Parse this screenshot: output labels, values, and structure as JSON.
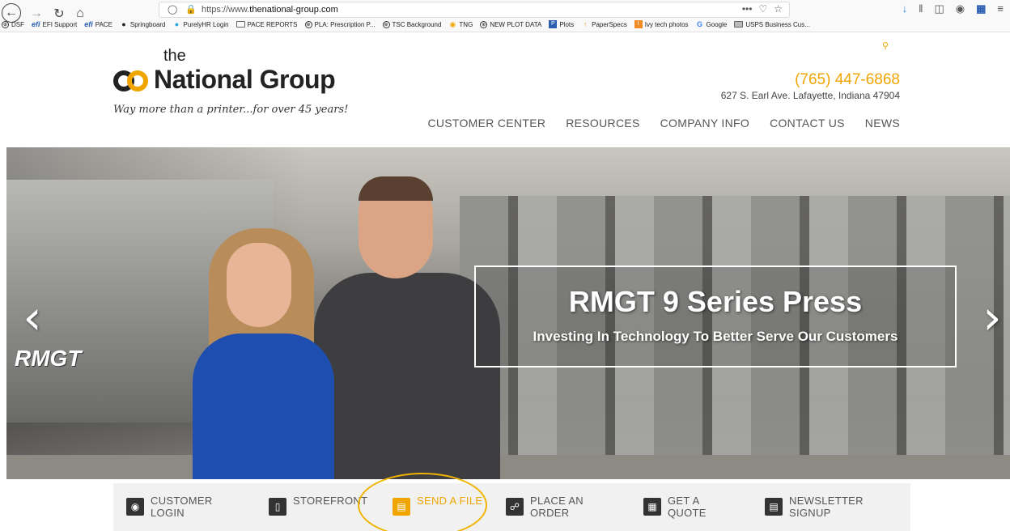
{
  "browser": {
    "url_prefix": "https://www.",
    "url_domain": "thenational-group.com",
    "url_actions": [
      "•••",
      "♡",
      "☆"
    ],
    "bookmarks": [
      {
        "label": "DSF",
        "icon": "globe-icon"
      },
      {
        "label": "EFI Support",
        "icon": "efi-icon"
      },
      {
        "label": "PACE",
        "icon": "efi-icon"
      },
      {
        "label": "Springboard",
        "icon": "springboard-icon"
      },
      {
        "label": "PurelyHR Login",
        "icon": "purelyhr-icon"
      },
      {
        "label": "PACE REPORTS",
        "icon": "folder-icon"
      },
      {
        "label": "PLA: Prescription P...",
        "icon": "globe-icon"
      },
      {
        "label": "TSC Background",
        "icon": "globe-icon"
      },
      {
        "label": "TNG",
        "icon": "tng-icon"
      },
      {
        "label": "NEW PLOT DATA",
        "icon": "globe-icon"
      },
      {
        "label": "Plots",
        "icon": "plots-icon"
      },
      {
        "label": "PaperSpecs",
        "icon": "pin-icon"
      },
      {
        "label": "Ivy tech photos",
        "icon": "ivy-icon"
      },
      {
        "label": "Google",
        "icon": "google-icon"
      },
      {
        "label": "USPS Business Cus...",
        "icon": "usps-icon"
      }
    ]
  },
  "header": {
    "logo_the": "the",
    "logo_name": "National Group",
    "logo_tagline": "Way more than a printer...for over 45 years!",
    "phone": "(765) 447-6868",
    "address": "627 S. Earl Ave. Lafayette, Indiana 47904"
  },
  "nav": {
    "items": [
      "CUSTOMER CENTER",
      "RESOURCES",
      "COMPANY INFO",
      "CONTACT US",
      "NEWS"
    ]
  },
  "hero": {
    "title": "RMGT 9 Series Press",
    "subtitle": "Investing In Technology To Better Serve Our Customers",
    "press_brand": "RMGT",
    "prev_arrow": "‹",
    "next_arrow": "›"
  },
  "quicklinks": [
    {
      "label": "CUSTOMER LOGIN",
      "icon": "lock-icon",
      "glyph": "🔒"
    },
    {
      "label": "STOREFRONT",
      "icon": "mouse-icon",
      "glyph": "▯"
    },
    {
      "label": "SEND A FILE",
      "icon": "folder-icon",
      "glyph": "▤",
      "active": true
    },
    {
      "label": "PLACE AN ORDER",
      "icon": "cart-icon",
      "glyph": "⌘"
    },
    {
      "label": "GET A QUOTE",
      "icon": "calculator-icon",
      "glyph": "▦"
    },
    {
      "label": "NEWSLETTER SIGNUP",
      "icon": "newsletter-icon",
      "glyph": "▤"
    }
  ],
  "colors": {
    "accent": "#f0a500",
    "nav_text": "#555555",
    "quicklinks_bg": "#f1f1f1"
  }
}
